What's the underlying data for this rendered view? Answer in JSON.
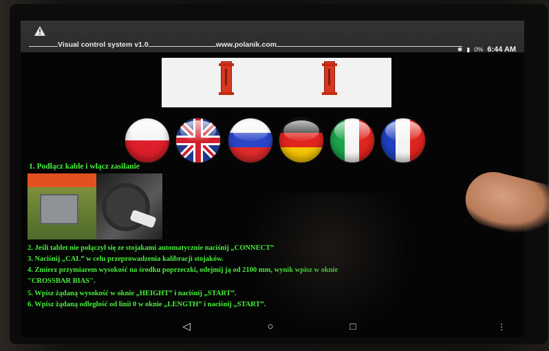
{
  "status_bar": {
    "app_title": "Visual control system v1.0",
    "website": "www.polanik.com",
    "battery": "0%",
    "time": "6:44 AM"
  },
  "icons": {
    "warning": "warning-icon",
    "bluetooth": "bluetooth-icon",
    "battery": "battery-icon",
    "back": "back-icon",
    "home": "home-icon",
    "recent": "recent-apps-icon",
    "menu": "menu-dots-icon"
  },
  "languages": [
    "Polski",
    "English",
    "Русский",
    "Deutsch",
    "Italiano",
    "Français"
  ],
  "instructions": {
    "step1": "1. Podłącz kable i włącz zasilanie",
    "step2": "2. Jeśli tablet nie połączył się ze stojakami automatycznie naciśnij „CONNECT”",
    "step3": "3. Naciśnij „CAL” w celu przeprowadzenia kalibracji stojaków.",
    "step4": "4. Zmierz przymiarem wysokość na środku poprzeczki, odejmij ją od 2100 mm, wynik wpisz w oknie",
    "step4b": "\"CROSSBAR BIAS\".",
    "step5": "5. Wpisz żądaną wysokość w oknie „HEIGHT” i naciśnij „START”.",
    "step6": "6. Wpisz żądaną odległość od linii 0 w oknie „LENGTH” i naciśnij „START”."
  },
  "nav": {
    "back_glyph": "◁",
    "home_glyph": "○",
    "recent_glyph": "□",
    "menu_glyph": "⋮"
  },
  "colors": {
    "instruction_text": "#47f03a",
    "stand": "#d8361f"
  }
}
